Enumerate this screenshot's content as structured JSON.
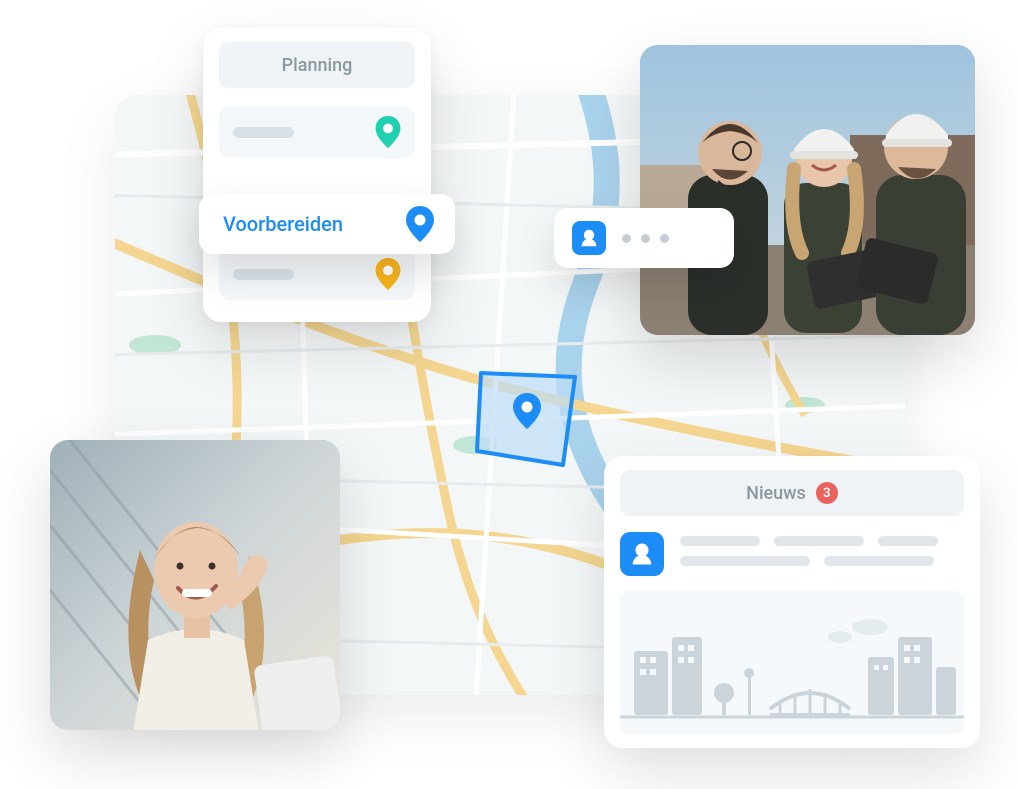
{
  "planning": {
    "title": "Planning",
    "items": [
      {
        "pin_color": "#1fd1b0"
      },
      {
        "pin_color": "#f7b41e"
      }
    ],
    "cta": {
      "label": "Voorbereiden",
      "pin_color": "#1c8cf7"
    }
  },
  "map": {
    "zone_pin_color": "#1c8cf7",
    "zone_fill": "#bedcf6",
    "zone_stroke": "#1c8cf7"
  },
  "typing": {
    "avatar_color": "#1c8cf7"
  },
  "news": {
    "title": "Nieuws",
    "badge": "3",
    "avatar_color": "#1c8cf7"
  }
}
